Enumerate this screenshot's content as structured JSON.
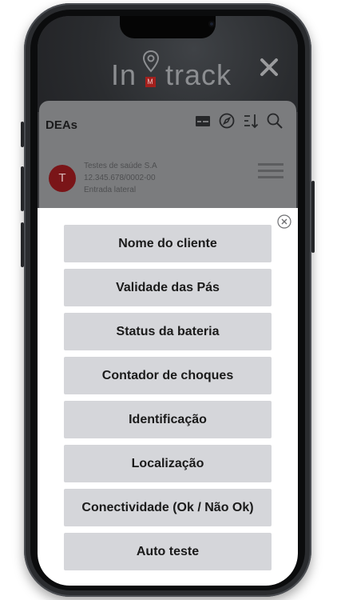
{
  "header": {
    "logo_left": "In",
    "logo_badge": "M",
    "logo_right": "track"
  },
  "background_list": {
    "title": "DEAs",
    "client": {
      "avatar_initial": "T",
      "name": "Testes de saúde S.A",
      "document": "12.345.678/0002-00",
      "location": "Entrada lateral"
    }
  },
  "sort_sheet": {
    "options": [
      "Nome do cliente",
      "Validade das Pás",
      "Status da bateria",
      "Contador de choques",
      "Identificação",
      "Localização",
      "Conectividade (Ok / Não Ok)",
      "Auto teste"
    ]
  },
  "colors": {
    "accent_red": "#a4201d",
    "option_bg": "#d5d6da",
    "overlay": "#7b7c7e"
  }
}
